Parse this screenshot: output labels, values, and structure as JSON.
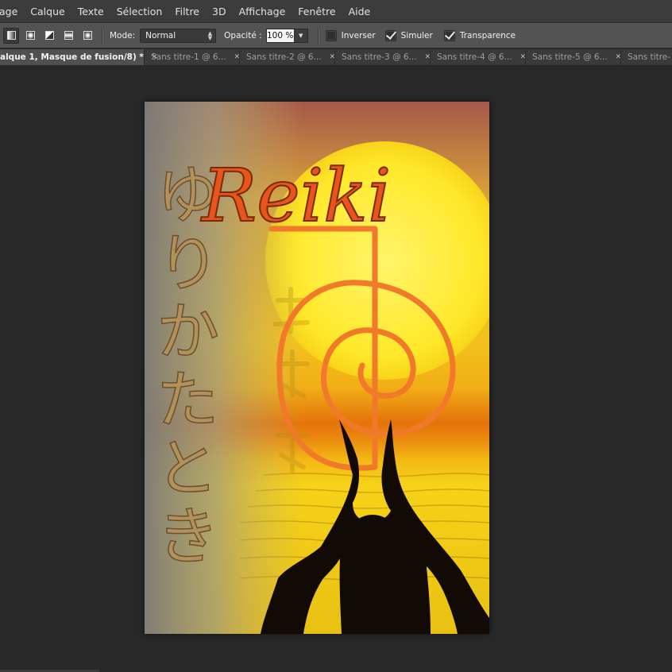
{
  "menu": [
    "age",
    "Calque",
    "Texte",
    "Sélection",
    "Filtre",
    "3D",
    "Affichage",
    "Fenêtre",
    "Aide"
  ],
  "options": {
    "mode_label": "Mode:",
    "mode_value": "Normal",
    "opacity_label": "Opacité :",
    "opacity_value": "100 %",
    "inverser": {
      "label": "Inverser",
      "checked": false
    },
    "simuler": {
      "label": "Simuler",
      "checked": true
    },
    "transparence": {
      "label": "Transparence",
      "checked": true
    }
  },
  "tabs": [
    {
      "label": "alque 1, Masque de fusion/8) *",
      "active": true
    },
    {
      "label": "Sans titre-1 @ 6...",
      "active": false
    },
    {
      "label": "Sans titre-2 @ 6...",
      "active": false
    },
    {
      "label": "Sans titre-3 @ 6...",
      "active": false
    },
    {
      "label": "Sans titre-4 @ 6...",
      "active": false
    },
    {
      "label": "Sans titre-5 @ 6...",
      "active": false
    },
    {
      "label": "Sans titre-",
      "active": false
    }
  ],
  "document": {
    "title_text": "Reiki",
    "vertical_text": "ゆりかたとき",
    "title_color": "#e8541a",
    "symbol_color": "#f07a2a"
  }
}
